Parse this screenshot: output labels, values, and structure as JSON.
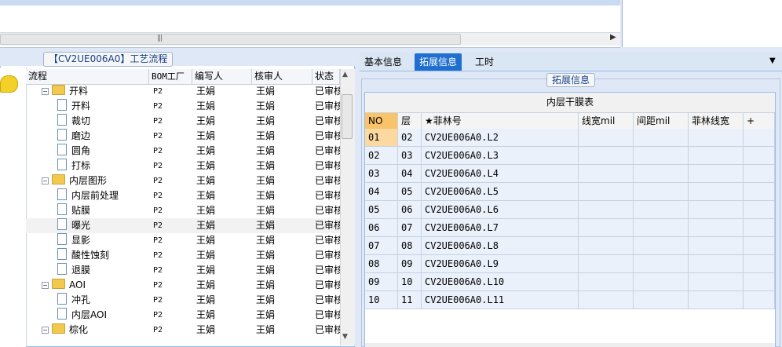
{
  "top_area": {
    "scroll_grip": "|||"
  },
  "left_panel": {
    "title": "【CV2UE006A0】工艺流程",
    "columns": [
      "流程",
      "BOM工厂",
      "编写人",
      "核审人",
      "状态"
    ],
    "rows": [
      {
        "indent": 1,
        "type": "folder",
        "expander": "−",
        "name": "开料",
        "bom": "P2",
        "writer": "王娟",
        "reviewer": "王娟",
        "status": "已审核"
      },
      {
        "indent": 2,
        "type": "doc",
        "name": "开料",
        "bom": "P2",
        "writer": "王娟",
        "reviewer": "王娟",
        "status": "已审核"
      },
      {
        "indent": 2,
        "type": "doc",
        "name": "裁切",
        "bom": "P2",
        "writer": "王娟",
        "reviewer": "王娟",
        "status": "已审核"
      },
      {
        "indent": 2,
        "type": "doc",
        "name": "磨边",
        "bom": "P2",
        "writer": "王娟",
        "reviewer": "王娟",
        "status": "已审核"
      },
      {
        "indent": 2,
        "type": "doc",
        "name": "圆角",
        "bom": "P2",
        "writer": "王娟",
        "reviewer": "王娟",
        "status": "已审核"
      },
      {
        "indent": 2,
        "type": "doc",
        "name": "打标",
        "bom": "P2",
        "writer": "王娟",
        "reviewer": "王娟",
        "status": "已审核"
      },
      {
        "indent": 1,
        "type": "folder",
        "expander": "−",
        "name": "内层图形",
        "bom": "P2",
        "writer": "王娟",
        "reviewer": "王娟",
        "status": "已审核"
      },
      {
        "indent": 2,
        "type": "doc",
        "name": "内层前处理",
        "bom": "P2",
        "writer": "王娟",
        "reviewer": "王娟",
        "status": "已审核"
      },
      {
        "indent": 2,
        "type": "doc",
        "name": "贴膜",
        "bom": "P2",
        "writer": "王娟",
        "reviewer": "王娟",
        "status": "已审核"
      },
      {
        "indent": 2,
        "type": "doc",
        "name": "曝光",
        "bom": "P2",
        "writer": "王娟",
        "reviewer": "王娟",
        "status": "已审核",
        "selected": true
      },
      {
        "indent": 2,
        "type": "doc",
        "name": "显影",
        "bom": "P2",
        "writer": "王娟",
        "reviewer": "王娟",
        "status": "已审核"
      },
      {
        "indent": 2,
        "type": "doc",
        "name": "酸性蚀刻",
        "bom": "P2",
        "writer": "王娟",
        "reviewer": "王娟",
        "status": "已审核"
      },
      {
        "indent": 2,
        "type": "doc",
        "name": "退膜",
        "bom": "P2",
        "writer": "王娟",
        "reviewer": "王娟",
        "status": "已审核"
      },
      {
        "indent": 1,
        "type": "folder",
        "expander": "−",
        "name": "AOI",
        "bom": "P2",
        "writer": "王娟",
        "reviewer": "王娟",
        "status": "已审核"
      },
      {
        "indent": 2,
        "type": "doc",
        "name": "冲孔",
        "bom": "P2",
        "writer": "王娟",
        "reviewer": "王娟",
        "status": "已审核"
      },
      {
        "indent": 2,
        "type": "doc",
        "name": "内层AOI",
        "bom": "P2",
        "writer": "王娟",
        "reviewer": "王娟",
        "status": "已审核"
      },
      {
        "indent": 1,
        "type": "folder",
        "expander": "−",
        "name": "棕化",
        "bom": "P2",
        "writer": "王娟",
        "reviewer": "王娟",
        "status": "已审核"
      }
    ]
  },
  "right_panel": {
    "tabs": [
      "基本信息",
      "拓展信息",
      "工时"
    ],
    "active_tab": "拓展信息",
    "section_title": "拓展信息",
    "grid": {
      "caption": "内层干膜表",
      "columns": [
        "NO",
        "层",
        "★菲林号",
        "线宽mil",
        "间距mil",
        "菲林线宽",
        "+"
      ],
      "rows": [
        [
          "01",
          "02",
          "CV2UE006A0.L2",
          "",
          "",
          ""
        ],
        [
          "02",
          "03",
          "CV2UE006A0.L3",
          "",
          "",
          ""
        ],
        [
          "03",
          "04",
          "CV2UE006A0.L4",
          "",
          "",
          ""
        ],
        [
          "04",
          "05",
          "CV2UE006A0.L5",
          "",
          "",
          ""
        ],
        [
          "05",
          "06",
          "CV2UE006A0.L6",
          "",
          "",
          ""
        ],
        [
          "06",
          "07",
          "CV2UE006A0.L7",
          "",
          "",
          ""
        ],
        [
          "07",
          "08",
          "CV2UE006A0.L8",
          "",
          "",
          ""
        ],
        [
          "08",
          "09",
          "CV2UE006A0.L9",
          "",
          "",
          ""
        ],
        [
          "09",
          "10",
          "CV2UE006A0.L10",
          "",
          "",
          ""
        ],
        [
          "10",
          "11",
          "CV2UE006A0.L11",
          "",
          "",
          ""
        ]
      ]
    }
  },
  "colors": {
    "accent": "#1f6fd0",
    "header_no": "#f9c36a",
    "row_bg": "#eaf1fb",
    "folder": "#f2c94c"
  }
}
